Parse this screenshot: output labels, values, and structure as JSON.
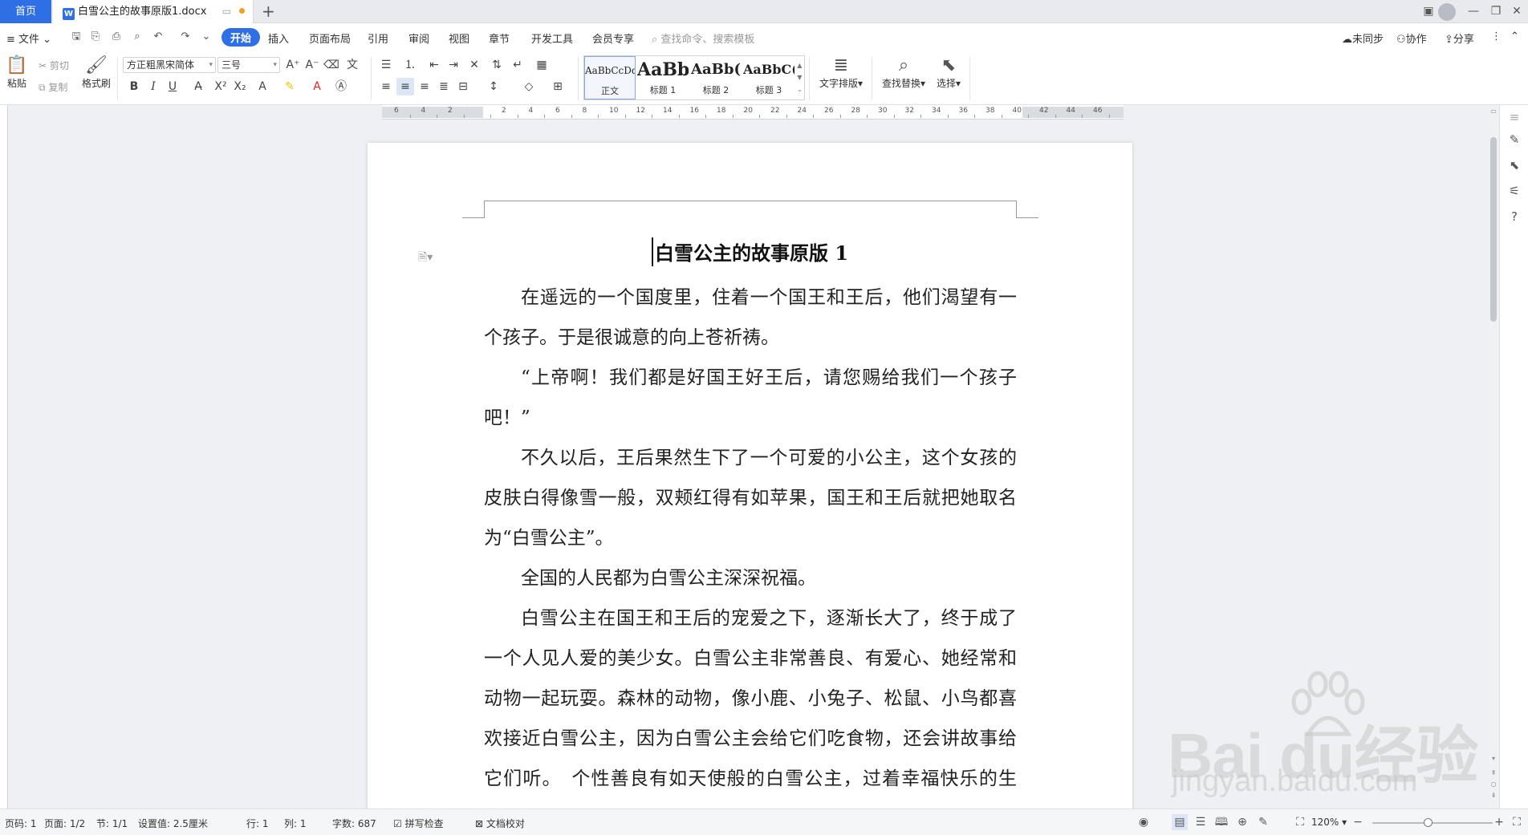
{
  "tabbar": {
    "home": "首页",
    "doc_icon": "W",
    "doc_title": "白雪公主的故事原版1.docx",
    "new_tab": "+"
  },
  "menubar": {
    "file": "≡ 文件 ⌄",
    "items": [
      "开始",
      "插入",
      "页面布局",
      "引用",
      "审阅",
      "视图",
      "章节",
      "开发工具",
      "会员专享"
    ],
    "search_placeholder": "查找命令、搜索模板",
    "sync": "未同步",
    "collab": "协作",
    "share": "分享"
  },
  "ribbon": {
    "paste": "粘贴",
    "cut": "剪切",
    "copy": "复制",
    "format_painter": "格式刷",
    "font_name": "方正粗黑宋简体",
    "font_size": "三号",
    "styles": [
      {
        "sample": "AaBbCcDd",
        "name": "正文"
      },
      {
        "sample": "AaBb",
        "name": "标题 1"
      },
      {
        "sample": "AaBb(",
        "name": "标题 2"
      },
      {
        "sample": "AaBbC(",
        "name": "标题 3"
      }
    ],
    "text_layout": "文字排版",
    "find_replace": "查找替换",
    "select": "选择"
  },
  "ruler": {
    "labels": [
      "6",
      "4",
      "2",
      "",
      "2",
      "4",
      "6",
      "8",
      "10",
      "12",
      "14",
      "16",
      "18",
      "20",
      "22",
      "24",
      "26",
      "28",
      "30",
      "32",
      "34",
      "36",
      "38",
      "40",
      "42",
      "44",
      "46"
    ]
  },
  "document": {
    "title": "白雪公主的故事原版 1",
    "paragraphs": [
      "在遥远的一个国度里，住着一个国王和王后，他们渴望有一个孩子。于是很诚意的向上苍祈祷。",
      "“上帝啊！我们都是好国王好王后，请您赐给我们一个孩子吧！”",
      "不久以后，王后果然生下了一个可爱的小公主，这个女孩的皮肤白得像雪一般，双颊红得有如苹果，国王和王后就把她取名为“白雪公主”。",
      "全国的人民都为白雪公主深深祝福。",
      "白雪公主在国王和王后的宠爱之下，逐渐长大了，终于成了一个人见人爱的美少女。白雪公主非常善良、有爱心、她经常和动物一起玩耍。森林的动物，像小鹿、小兔子、松鼠、小鸟都喜欢接近白雪公主，因为白雪公主会给它们吃食物，还会讲故事给它们听。　个性善良有如天使般的白雪公主，过着幸福快乐的生活。"
    ]
  },
  "statusbar": {
    "page_code": "页码: 1",
    "pages": "页面: 1/2",
    "section": "节: 1/1",
    "setting": "设置值: 2.5厘米",
    "row": "行: 1",
    "col": "列: 1",
    "words": "字数: 687",
    "spell_check": "拼写检查",
    "doc_proof": "文档校对",
    "zoom": "120%"
  },
  "watermark": {
    "logo": "Bai du经验",
    "url": "jingyan.baidu.com"
  },
  "colors": {
    "accent": "#2f6fe6",
    "unsaved_dot": "#f0a020"
  }
}
